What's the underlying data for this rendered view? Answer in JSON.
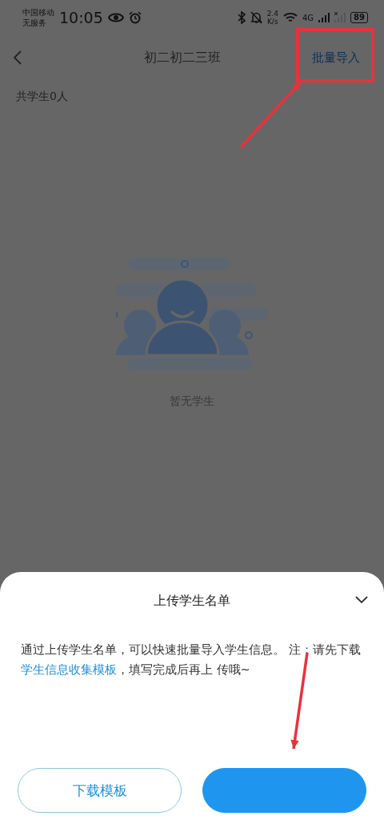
{
  "status_bar": {
    "carrier": "中国移动",
    "service": "无服务",
    "time": "10:05",
    "speed_value": "2.4",
    "speed_unit": "K/s",
    "network": "4G",
    "battery": "89"
  },
  "header": {
    "title": "初二初二三班",
    "action": "批量导入"
  },
  "student_count": "共学生0人",
  "empty_state": {
    "label": "暂无学生"
  },
  "sheet": {
    "title": "上传学生名单",
    "description_start": "通过上传学生名单，可以快速批量导入学生信息。 注：请先下载",
    "link": "学生信息收集模板",
    "description_end": "，填写完成后再上 传哦~",
    "buttons": [
      {
        "kind": "outline",
        "label": "下载模板"
      },
      {
        "kind": "filled"
      }
    ]
  },
  "annotations": [
    {
      "kind": "highlight-box"
    },
    {
      "kind": "arrow"
    },
    {
      "kind": "arrow"
    }
  ]
}
